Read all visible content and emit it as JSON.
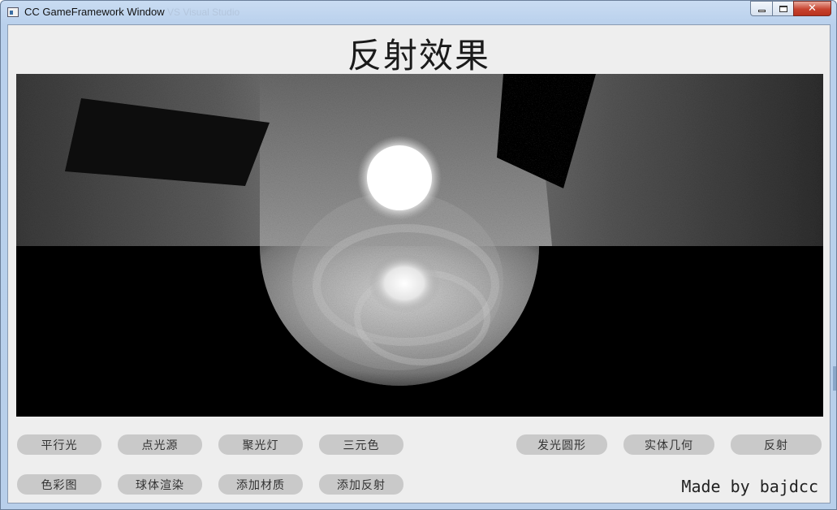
{
  "window": {
    "title": "CC GameFramework Window",
    "ghost_title": "VS Visual Studio",
    "controls": {
      "minimize": "minimize",
      "maximize": "maximize",
      "close": "✕"
    }
  },
  "page": {
    "title": "反射效果",
    "footer": "Made by bajdcc"
  },
  "buttons_row1": [
    "平行光",
    "点光源",
    "聚光灯",
    "三元色"
  ],
  "buttons_row1_right": [
    "发光圆形",
    "实体几何",
    "反射"
  ],
  "buttons_row2": [
    "色彩图",
    "球体渲染",
    "添加材质",
    "添加反射"
  ],
  "colors": {
    "client_bg": "#eeeeee",
    "button_bg": "#c9c9c9",
    "canvas_bg": "#000000",
    "close_button": "#c7432f"
  },
  "icons": {
    "app": "app-window-icon"
  }
}
